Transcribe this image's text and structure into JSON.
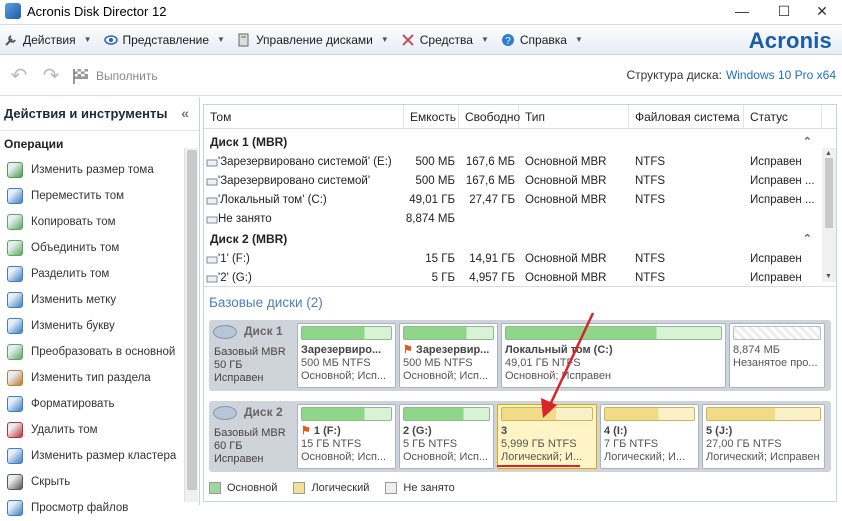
{
  "window": {
    "title": "Acronis Disk Director 12",
    "minimize": "—",
    "maximize": "☐",
    "close": "✕"
  },
  "menu": [
    {
      "label": "Действия",
      "icon": "wrench-icon"
    },
    {
      "label": "Представление",
      "icon": "eye-icon"
    },
    {
      "label": "Управление дисками",
      "icon": "disk-manage-icon"
    },
    {
      "label": "Средства",
      "icon": "tools-icon"
    },
    {
      "label": "Справка",
      "icon": "help-icon"
    }
  ],
  "brand": "Acronis",
  "toolbar": {
    "undo_icon": "undo-icon",
    "redo_icon": "redo-icon",
    "run_label": "Выполнить"
  },
  "disk_structure": {
    "label": "Структура диска:",
    "value": "Windows 10 Pro x64"
  },
  "left_panel": {
    "title": "Действия и инструменты",
    "section": "Операции",
    "operations": [
      {
        "label": "Изменить размер тома",
        "color": "#4a9a4a"
      },
      {
        "label": "Переместить том",
        "color": "#3b7fc4"
      },
      {
        "label": "Копировать том",
        "color": "#5aa85a"
      },
      {
        "label": "Объединить том",
        "color": "#5aa85a"
      },
      {
        "label": "Разделить том",
        "color": "#3b7fc4"
      },
      {
        "label": "Изменить метку",
        "color": "#3b7fc4"
      },
      {
        "label": "Изменить букву",
        "color": "#3b7fc4"
      },
      {
        "label": "Преобразовать в основной",
        "color": "#5aa85a"
      },
      {
        "label": "Изменить тип раздела",
        "color": "#c07a2a"
      },
      {
        "label": "Форматировать",
        "color": "#3b7fc4"
      },
      {
        "label": "Удалить том",
        "color": "#c03030"
      },
      {
        "label": "Изменить размер кластера",
        "color": "#3b7fc4"
      },
      {
        "label": "Скрыть",
        "color": "#555555"
      },
      {
        "label": "Просмотр файлов",
        "color": "#3b7fc4"
      }
    ]
  },
  "table": {
    "columns": [
      "Том",
      "Емкость",
      "Свободно",
      "Тип",
      "Файловая система",
      "Статус"
    ],
    "groups": [
      {
        "name": "Диск 1 (MBR)",
        "rows": [
          {
            "vol": "'Зарезервировано системой' (E:)",
            "cap": "500 МБ",
            "free": "167,6 МБ",
            "type": "Основной MBR",
            "fs": "NTFS",
            "status": "Исправен"
          },
          {
            "vol": "'Зарезервировано системой'",
            "cap": "500 МБ",
            "free": "167,6 МБ",
            "type": "Основной MBR",
            "fs": "NTFS",
            "status": "Исправен ..."
          },
          {
            "vol": "'Локальный том' (C:)",
            "cap": "49,01 ГБ",
            "free": "27,47 ГБ",
            "type": "Основной MBR",
            "fs": "NTFS",
            "status": "Исправен ..."
          },
          {
            "vol": "Не занято",
            "cap": "8,874 МБ",
            "free": "",
            "type": "",
            "fs": "",
            "status": ""
          }
        ]
      },
      {
        "name": "Диск 2 (MBR)",
        "rows": [
          {
            "vol": "'1' (F:)",
            "cap": "15 ГБ",
            "free": "14,91 ГБ",
            "type": "Основной MBR",
            "fs": "NTFS",
            "status": "Исправен"
          },
          {
            "vol": "'2' (G:)",
            "cap": "5 ГБ",
            "free": "4,957 ГБ",
            "type": "Основной MBR",
            "fs": "NTFS",
            "status": "Исправен"
          }
        ]
      }
    ]
  },
  "basic_disks": {
    "title": "Базовые диски (2)",
    "disks": [
      {
        "name": "Диск 1",
        "type": "Базовый MBR",
        "size": "50 ГБ",
        "status": "Исправен",
        "partitions": [
          {
            "name": "Зарезервиро...",
            "size": "500 МБ NTFS",
            "info": "Основной; Исп...",
            "kind": "primary",
            "flag": false
          },
          {
            "name": "Зарезервир...",
            "size": "500 МБ NTFS",
            "info": "Основной; Исп...",
            "kind": "primary",
            "flag": true
          },
          {
            "name": "Локальный том (C:)",
            "size": "49,01 ГБ NTFS",
            "info": "Основной; Исправен",
            "kind": "primary",
            "flag": false
          },
          {
            "name": "",
            "size": "8,874 МБ",
            "info": "Незанятое про...",
            "kind": "free",
            "flag": false
          }
        ]
      },
      {
        "name": "Диск 2",
        "type": "Базовый MBR",
        "size": "60 ГБ",
        "status": "Исправен",
        "partitions": [
          {
            "name": "1 (F:)",
            "size": "15 ГБ NTFS",
            "info": "Основной; Исп...",
            "kind": "primary",
            "flag": true
          },
          {
            "name": "2 (G:)",
            "size": "5 ГБ NTFS",
            "info": "Основной; Исп...",
            "kind": "primary",
            "flag": false
          },
          {
            "name": "3",
            "size": "5,999 ГБ NTFS",
            "info": "Логический; И...",
            "kind": "logical",
            "flag": false
          },
          {
            "name": "4 (I:)",
            "size": "7 ГБ NTFS",
            "info": "Логический; И...",
            "kind": "logical",
            "flag": false
          },
          {
            "name": "5 (J:)",
            "size": "27,00 ГБ NTFS",
            "info": "Логический; Исправен",
            "kind": "logical",
            "flag": false
          }
        ]
      }
    ],
    "legend": [
      {
        "label": "Основной",
        "color": "#9ed89a"
      },
      {
        "label": "Логический",
        "color": "#f3e19a"
      },
      {
        "label": "Не занято",
        "color": "#eeeeee"
      }
    ]
  },
  "colors": {
    "primary_bar": "#8fd68a",
    "logical_bar": "#f1db86",
    "selected_border": "#e0a800",
    "arrow": "#d8242a"
  }
}
